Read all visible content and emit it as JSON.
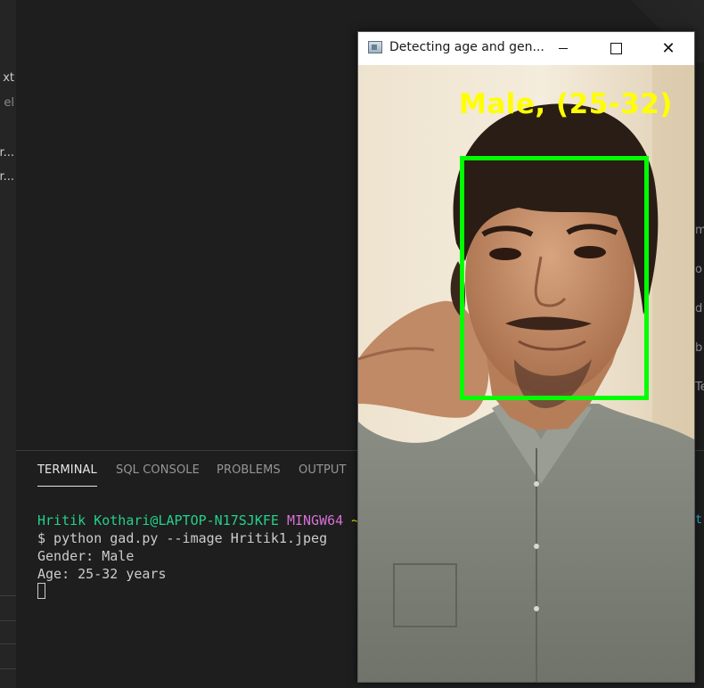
{
  "sidebar": {
    "fragments": [
      "xt",
      "el",
      "r...",
      "r..."
    ]
  },
  "panel": {
    "tabs": [
      {
        "label": "TERMINAL",
        "active": true
      },
      {
        "label": "SQL CONSOLE",
        "active": false
      },
      {
        "label": "PROBLEMS",
        "active": false
      },
      {
        "label": "OUTPUT",
        "active": false
      }
    ]
  },
  "terminal": {
    "prompt_user": "Hritik Kothari@LAPTOP-N17SJKFE",
    "prompt_env": "MINGW64",
    "prompt_tilde": "~",
    "command": "$ python gad.py --image Hritik1.jpeg",
    "output_gender": "Gender: Male",
    "output_age": "Age: 25-32 years"
  },
  "right_fragments": [
    "m",
    "o",
    "d",
    "b",
    "Te",
    "t"
  ],
  "cv_window": {
    "title": "Detecting age and gen...",
    "detection_label": "Male, (25-32)",
    "box_color": "#00ff00",
    "label_color": "#ffff00"
  }
}
